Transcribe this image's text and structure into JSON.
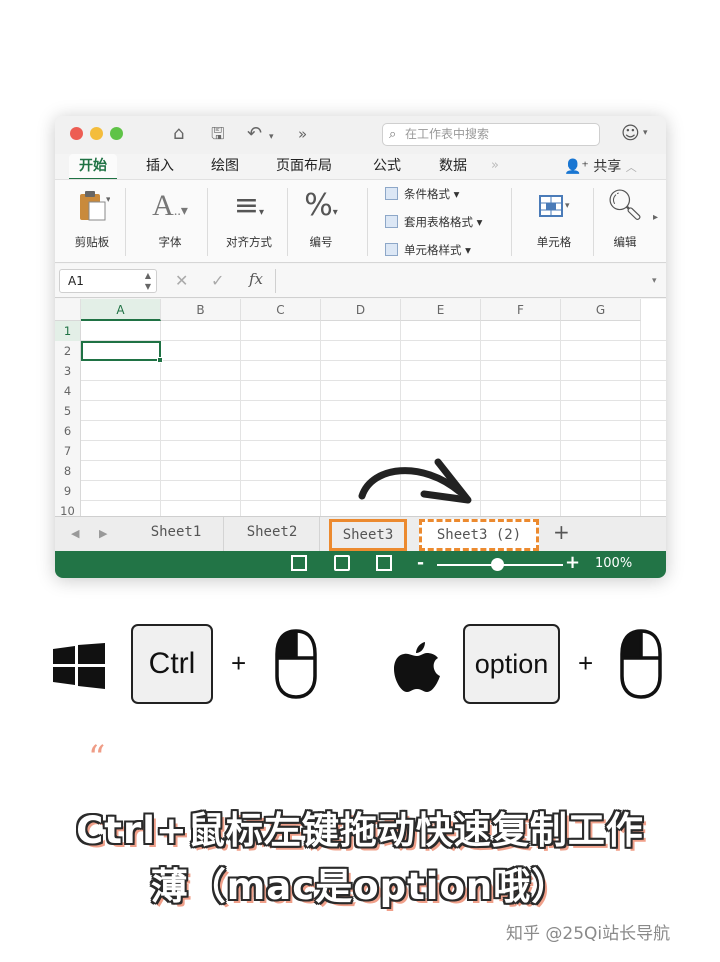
{
  "window": {
    "search_placeholder": "在工作表中搜索",
    "tabs": [
      "开始",
      "插入",
      "绘图",
      "页面布局",
      "公式",
      "数据"
    ],
    "share": "共享",
    "ribbon": {
      "paste": "剪贴板",
      "font": "字体",
      "align": "对齐方式",
      "number": "编号",
      "cond_format": "条件格式",
      "table_format": "套用表格格式",
      "cell_style": "单元格样式",
      "cells": "单元格",
      "edit": "编辑"
    },
    "name_box": "A1",
    "fx_label": "fx",
    "columns": [
      "A",
      "B",
      "C",
      "D",
      "E",
      "F",
      "G"
    ],
    "rows": [
      "1",
      "2",
      "3",
      "4",
      "5",
      "6",
      "7",
      "8",
      "9",
      "10"
    ],
    "sheets": [
      "Sheet1",
      "Sheet2",
      "Sheet3",
      "Sheet3 (2)"
    ],
    "add_sheet": "+",
    "zoom_minus": "-",
    "zoom_plus": "+",
    "zoom": "100%"
  },
  "shortcuts": {
    "windows_key": "Ctrl",
    "mac_key": "option",
    "plus": "+"
  },
  "caption": {
    "quote_mark": "“",
    "line1": "Ctrl+鼠标左键拖动快速复制工作",
    "line2": "薄（mac是option哦）"
  },
  "watermark": "知乎 @25Qi站长导航",
  "colors": {
    "excel_green": "#227446",
    "highlight_orange": "#ec8a2f",
    "accent_pink": "#f0a08a"
  }
}
